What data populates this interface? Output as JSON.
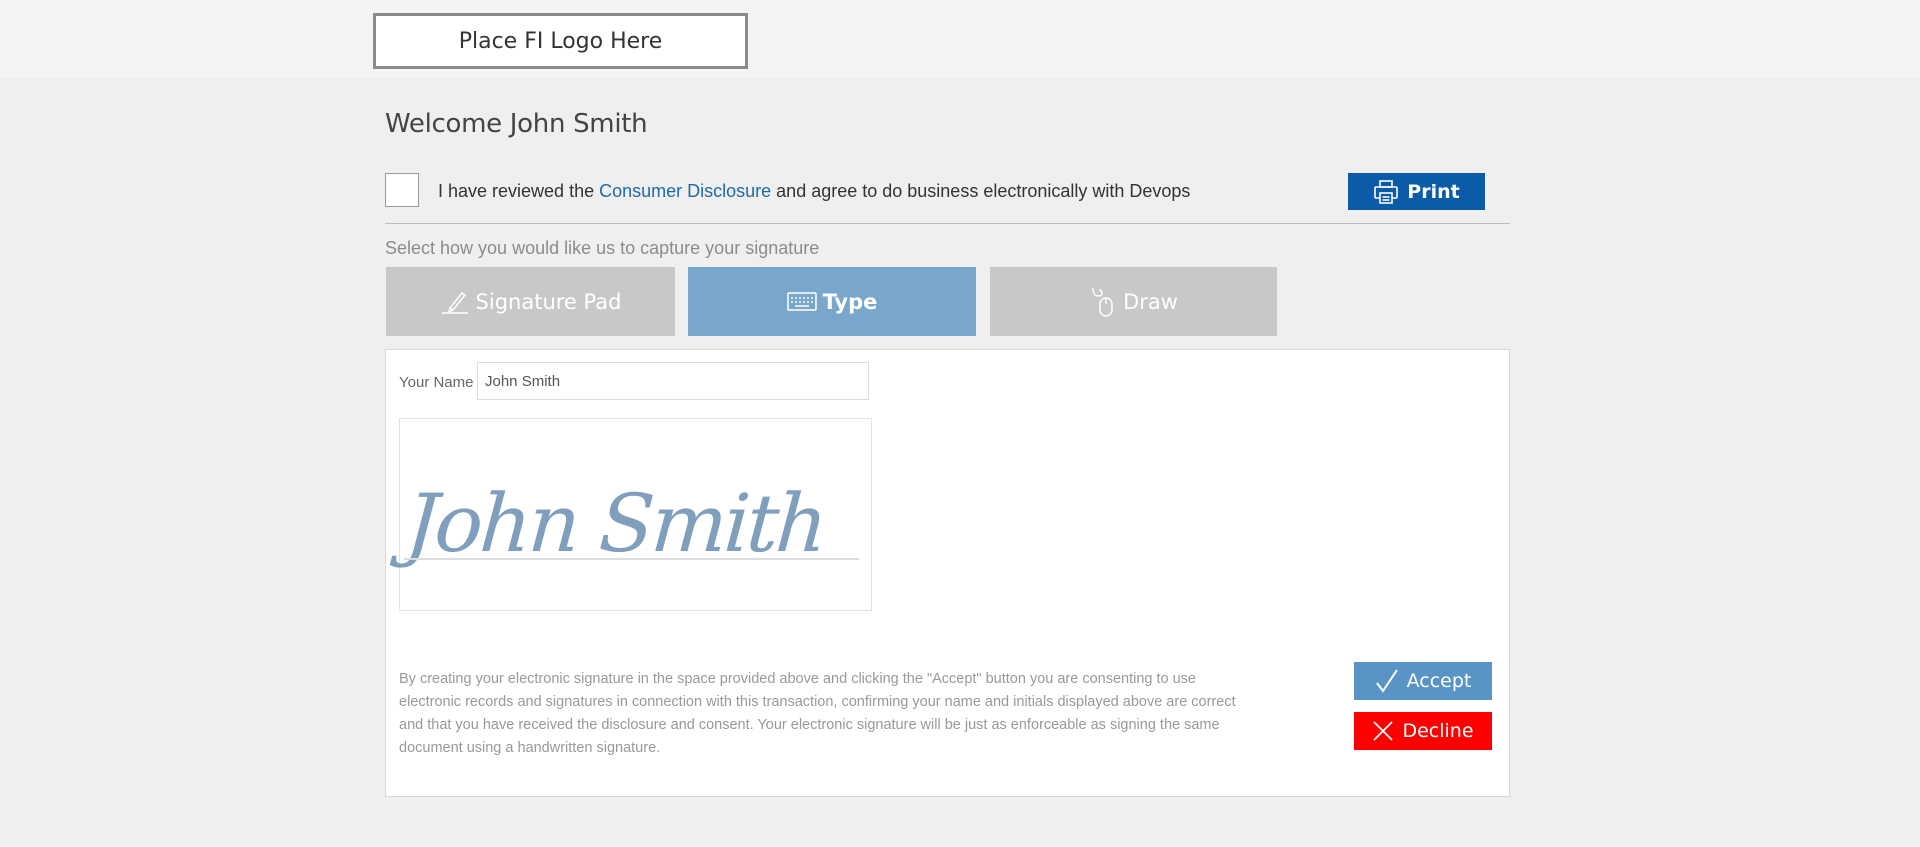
{
  "header": {
    "logo_text": "Place FI Logo Here"
  },
  "welcome": {
    "title": "Welcome John Smith"
  },
  "consent": {
    "text_before": "I have reviewed the ",
    "link_text": "Consumer Disclosure",
    "text_after": " and agree to do business electronically with Devops",
    "print_label": "Print"
  },
  "capture": {
    "prompt": "Select how you would like us to capture your signature",
    "tabs": [
      {
        "label": "Signature Pad",
        "icon": "pen-nib-icon",
        "active": false
      },
      {
        "label": "Type",
        "icon": "keyboard-icon",
        "active": true
      },
      {
        "label": "Draw",
        "icon": "mouse-icon",
        "active": false
      }
    ]
  },
  "form": {
    "name_label": "Your Name",
    "name_value": "John Smith",
    "signature_preview": "John Smith"
  },
  "legal": {
    "text": "By creating your electronic signature in the space provided above and clicking the \"Accept\" button you are consenting to use electronic records and signatures in connection with this transaction, confirming your name and initials displayed above are correct and that you have received the disclosure and consent. Your electronic signature will be just as enforceable as signing the same document using a handwritten signature."
  },
  "actions": {
    "accept_label": "Accept",
    "decline_label": "Decline"
  },
  "colors": {
    "print_button": "#0b5ba8",
    "active_tab": "#78a7cb",
    "inactive_tab": "#c9c8c8",
    "accept_button": "#5a93c6",
    "decline_button": "#ff0000",
    "link": "#1b6aab"
  }
}
